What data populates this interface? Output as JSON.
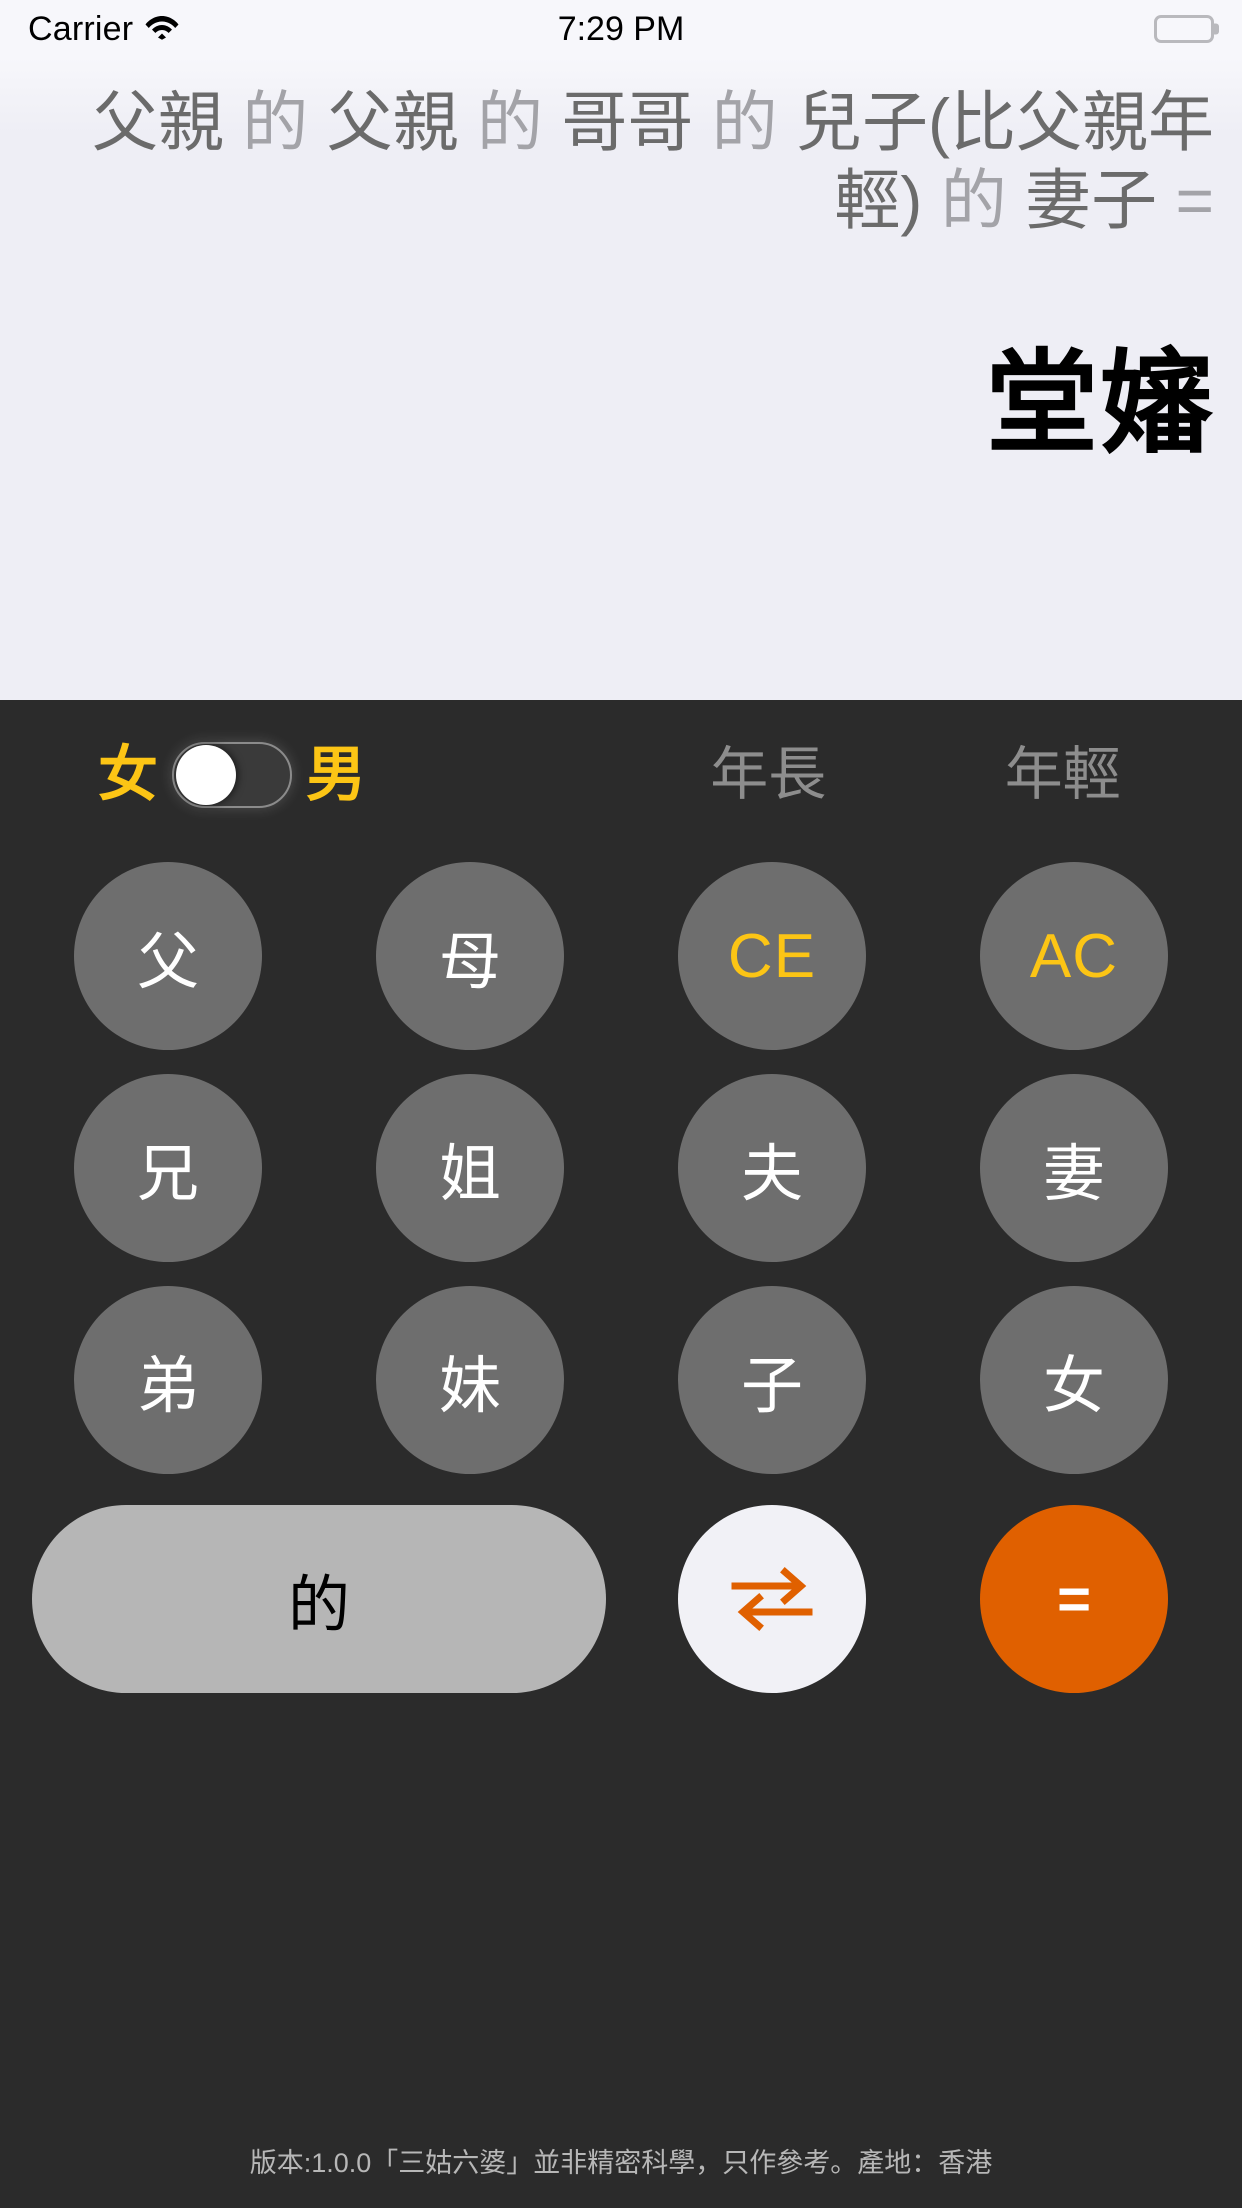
{
  "statusbar": {
    "carrier": "Carrier",
    "time": "7:29 PM",
    "wifi_icon": "wifi-icon",
    "battery_icon": "battery-icon"
  },
  "display": {
    "expression_full": "父親 的 父親 的 哥哥 的 兒子(比父親年輕) 的 妻子 =",
    "expression_tokens": [
      {
        "text": "父親",
        "kind": "term"
      },
      {
        "text": "的",
        "kind": "de"
      },
      {
        "text": "父親",
        "kind": "term"
      },
      {
        "text": "的",
        "kind": "de"
      },
      {
        "text": "哥哥",
        "kind": "term"
      },
      {
        "text": "的",
        "kind": "de"
      },
      {
        "text": "兒子(比父親年輕)",
        "kind": "term"
      },
      {
        "text": "的",
        "kind": "de"
      },
      {
        "text": "妻子",
        "kind": "term"
      },
      {
        "text": "=",
        "kind": "eq"
      }
    ],
    "result": "堂嬸"
  },
  "keypad": {
    "gender_toggle": {
      "left_label": "女",
      "right_label": "男",
      "state": "left",
      "accent_color": "#fcc515"
    },
    "age_labels": {
      "older": "年長",
      "younger": "年輕"
    },
    "rows": [
      [
        {
          "label": "父",
          "style": "normal",
          "name": "key-father"
        },
        {
          "label": "母",
          "style": "normal",
          "name": "key-mother"
        },
        {
          "label": "CE",
          "style": "accent",
          "name": "key-clear-entry"
        },
        {
          "label": "AC",
          "style": "accent",
          "name": "key-all-clear"
        }
      ],
      [
        {
          "label": "兄",
          "style": "normal",
          "name": "key-elder-brother"
        },
        {
          "label": "姐",
          "style": "normal",
          "name": "key-elder-sister"
        },
        {
          "label": "夫",
          "style": "normal",
          "name": "key-husband"
        },
        {
          "label": "妻",
          "style": "normal",
          "name": "key-wife"
        }
      ],
      [
        {
          "label": "弟",
          "style": "normal",
          "name": "key-younger-brother"
        },
        {
          "label": "妹",
          "style": "normal",
          "name": "key-younger-sister"
        },
        {
          "label": "子",
          "style": "normal",
          "name": "key-son"
        },
        {
          "label": "女",
          "style": "normal",
          "name": "key-daughter"
        }
      ]
    ],
    "bottom": {
      "possessive_label": "的",
      "swap_icon": "swap-arrows-icon",
      "equals_label": "=",
      "equals_color": "#e06000",
      "swap_icon_color": "#e06000"
    }
  },
  "footer": {
    "text": "版本:1.0.0「三姑六婆」並非精密科學，只作參考。產地：香港"
  }
}
